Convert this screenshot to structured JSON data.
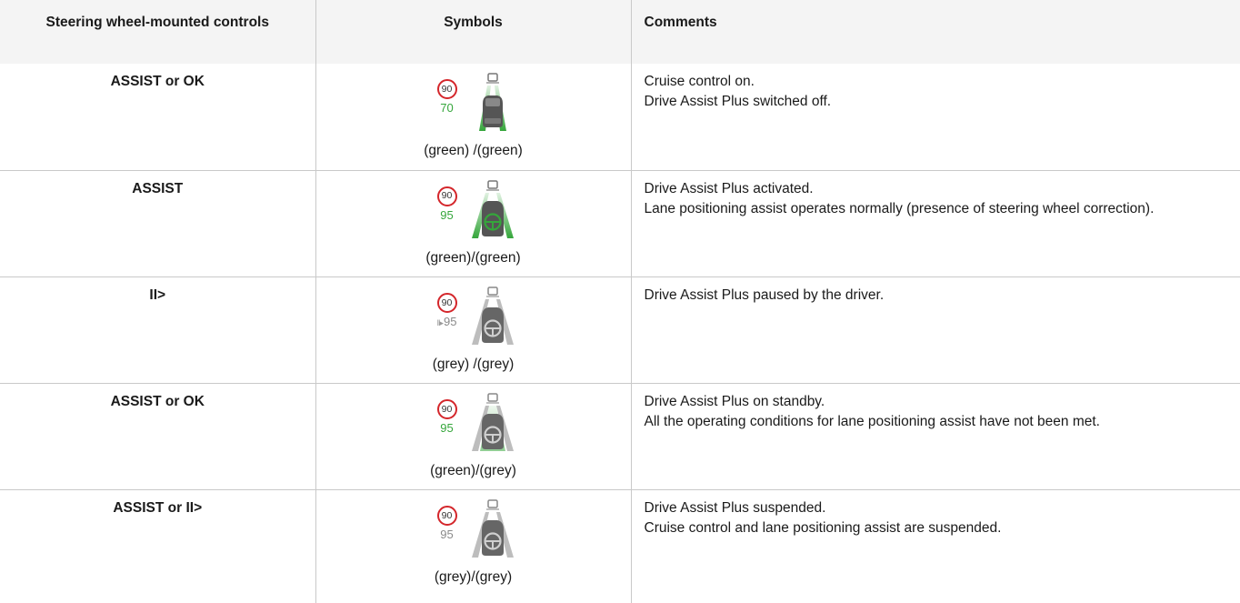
{
  "headers": {
    "controls": "Steering wheel-mounted controls",
    "symbols": "Symbols",
    "comments": "Comments"
  },
  "colors": {
    "green": "#35a63b",
    "grey": "#9a9a9a",
    "limit_ring": "#d4262b"
  },
  "rows": [
    {
      "control": "ASSIST or OK",
      "limit": "90",
      "set_speed": "70",
      "speed_color": "green",
      "paused_icon": "",
      "lane_icon": "car-lane-green-icon",
      "caption": "(green) /(green)",
      "comments": [
        "Cruise control on.",
        "Drive Assist Plus switched off."
      ]
    },
    {
      "control": "ASSIST",
      "limit": "90",
      "set_speed": "95",
      "speed_color": "green",
      "paused_icon": "",
      "lane_icon": "steering-wheel-lane-green-icon",
      "caption": "(green)/(green)",
      "comments": [
        "Drive Assist Plus activated.",
        "Lane positioning assist operates normally (presence of steering wheel correction)."
      ]
    },
    {
      "control": "II>",
      "limit": "90",
      "set_speed": "95",
      "speed_color": "grey",
      "paused_icon": "II▸",
      "lane_icon": "steering-wheel-lane-grey-icon",
      "caption": "(grey) /(grey)",
      "comments": [
        "Drive Assist Plus paused by the driver."
      ]
    },
    {
      "control": "ASSIST or OK",
      "limit": "90",
      "set_speed": "95",
      "speed_color": "green",
      "paused_icon": "",
      "lane_icon": "steering-wheel-lane-grey-icon",
      "caption": "(green)/(grey)",
      "comments": [
        "Drive Assist Plus on standby.",
        "All the operating conditions for lane positioning assist have not been met."
      ]
    },
    {
      "control": "ASSIST or II>",
      "limit": "90",
      "set_speed": "95",
      "speed_color": "grey",
      "paused_icon": "",
      "lane_icon": "steering-wheel-lane-grey-icon",
      "caption": "(grey)/(grey)",
      "comments": [
        "Drive Assist Plus suspended.",
        "Cruise control and lane positioning assist are suspended."
      ]
    }
  ]
}
